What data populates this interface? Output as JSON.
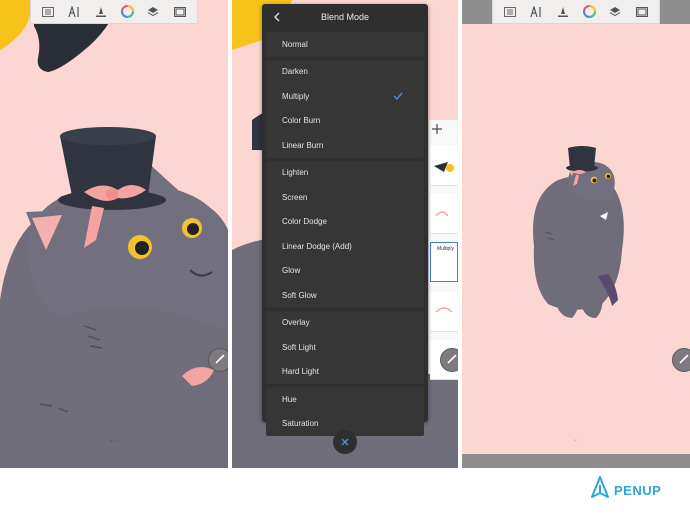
{
  "blend_mode": {
    "title": "Blend Mode",
    "groups": [
      [
        {
          "label": "Normal"
        }
      ],
      [
        {
          "label": "Darken"
        },
        {
          "label": "Multiply",
          "selected": true
        },
        {
          "label": "Color Burn"
        },
        {
          "label": "Linear Burn"
        }
      ],
      [
        {
          "label": "Lighten"
        },
        {
          "label": "Screen"
        },
        {
          "label": "Color Dodge"
        },
        {
          "label": "Linear Dodge (Add)"
        },
        {
          "label": "Glow"
        },
        {
          "label": "Soft Glow"
        }
      ],
      [
        {
          "label": "Overlay"
        },
        {
          "label": "Soft Light"
        },
        {
          "label": "Hard Light"
        }
      ],
      [
        {
          "label": "Hue"
        },
        {
          "label": "Saturation"
        }
      ]
    ]
  },
  "layers": {
    "selected_label": "Multiply"
  },
  "brand": {
    "name": "PENUP",
    "color": "#2aa7d6"
  },
  "colors": {
    "canvas_bg": "#fcd6d2",
    "cat_body": "#6f6d7a",
    "hat": "#2f3440",
    "ribbon": "#f4a3a0",
    "eye": "#f2c12e",
    "dialog_bg": "#2f2f30",
    "check": "#4a90d9"
  },
  "icons": {
    "toolbar": [
      "menu-icon",
      "text-brush-icon",
      "pen-icon",
      "color-wheel-icon",
      "layers-icon",
      "canvas-icon"
    ],
    "pencil": "pencil-icon",
    "close": "close-icon",
    "back": "back-arrow-icon",
    "check": "check-icon"
  }
}
